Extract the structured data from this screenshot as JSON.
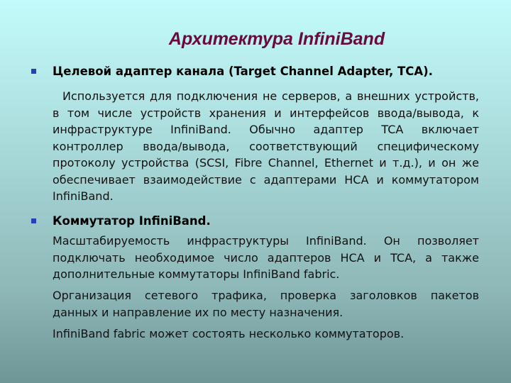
{
  "slide": {
    "title": "Архитектура InfiniBand",
    "bullet_color": "#2a3fb0",
    "title_color": "#6b0a3c",
    "sections": [
      {
        "heading": "Целевой адаптер канала (Target Channel Adapter, TCA).",
        "paragraphs": [
          "Используется для подключения не серверов, а внешних устройств, в том числе устройств хранения и интерфейсов ввода/вывода, к инфраструктуре InfiniBand. Обычно адаптер TCA включает контроллер ввода/вывода, соответствующий специфическому протоколу устройства (SCSI, Fibre Channel, Ethernet и т.д.), и он же обеспечивает взаимодействие с адаптерами HCA и коммутатором InfiniBand."
        ]
      },
      {
        "heading": "Коммутатор InfiniBand.",
        "paragraphs": [
          "Масштабируемость инфраструктуры InfiniBand. Он позволяет подключать необходимое число адаптеров HCA и TCA, а также дополнительные коммутаторы InfiniBand fabric.",
          "Организация сетевого трафика, проверка заголовков пакетов данных и направление их по месту назначения.",
          "InfiniBand fabric может состоять несколько коммутаторов."
        ]
      }
    ]
  }
}
